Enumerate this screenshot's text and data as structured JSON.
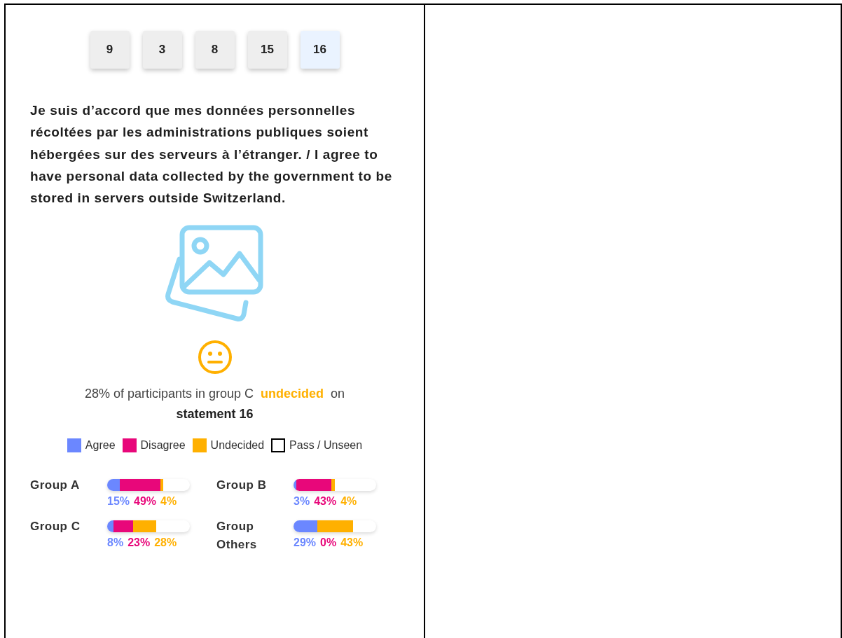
{
  "statement_tabs": [
    {
      "label": "9",
      "selected": false
    },
    {
      "label": "3",
      "selected": false
    },
    {
      "label": "8",
      "selected": false
    },
    {
      "label": "15",
      "selected": false
    },
    {
      "label": "16",
      "selected": true
    }
  ],
  "statement": "Je suis d’accord que mes données personnelles récoltées par les administrations publiques soient hébergées sur des serveurs à l’étranger. / I agree to have personal data collected by the government to be stored in servers outside Switzerland.",
  "summary": {
    "prefix": "28% of participants in group C",
    "vote": {
      "text": "undecided",
      "kind": "undecided"
    },
    "suffix": "on",
    "statement": "statement 16"
  },
  "legend": [
    {
      "label": "Agree",
      "kind": "agree",
      "color": "#6b87ff"
    },
    {
      "label": "Disagree",
      "kind": "disagree",
      "color": "#e8077a"
    },
    {
      "label": "Undecided",
      "kind": "undecided",
      "color": "#ffb000"
    },
    {
      "label": "Pass / Unseen",
      "kind": "pass"
    }
  ],
  "groups": [
    {
      "name": "Group A",
      "segments": [
        {
          "kind": "agree",
          "label": "15%"
        },
        {
          "kind": "disagree",
          "label": "49%"
        },
        {
          "kind": "undecided",
          "label": "4%"
        }
      ]
    },
    {
      "name": "Group B",
      "segments": [
        {
          "kind": "agree",
          "label": "3%"
        },
        {
          "kind": "disagree",
          "label": "43%"
        },
        {
          "kind": "undecided",
          "label": "4%"
        }
      ]
    },
    {
      "name": "Group C",
      "segments": [
        {
          "kind": "agree",
          "label": "8%"
        },
        {
          "kind": "disagree",
          "label": "23%"
        },
        {
          "kind": "undecided",
          "label": "28%"
        }
      ]
    },
    {
      "name": "Group Others",
      "segments": [
        {
          "kind": "agree",
          "label": "29%"
        },
        {
          "kind": "disagree",
          "label": "0%"
        },
        {
          "kind": "undecided",
          "label": "43%"
        }
      ]
    }
  ]
}
